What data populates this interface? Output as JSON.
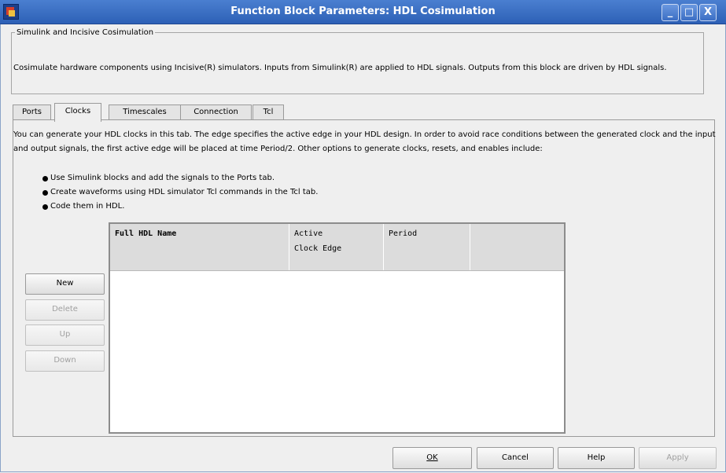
{
  "window": {
    "title": "Function Block Parameters: HDL Cosimulation",
    "controls": [
      "_",
      "□",
      "X"
    ],
    "title_bar_color": "#3a6cc0"
  },
  "group": {
    "legend": "Simulink and Incisive Cosimulation",
    "description": "Cosimulate hardware components using Incisive(R) simulators.  Inputs from Simulink(R) are applied to HDL signals.  Outputs from this block are driven by HDL signals."
  },
  "tabs": [
    {
      "label": "Ports",
      "active": false
    },
    {
      "label": "Clocks",
      "active": true
    },
    {
      "label": "Timescales",
      "active": false
    },
    {
      "label": "Connection",
      "active": false
    },
    {
      "label": "Tcl",
      "active": false
    }
  ],
  "clocks": {
    "intro": "You can generate your HDL clocks in this tab. The edge specifies the active edge in your HDL design. In order to avoid race conditions between the generated clock and the input and output signals, the first active edge will be placed at time Period/2. Other options to generate clocks, resets, and enables include:",
    "bullets": [
      "Use Simulink blocks and add the signals to the Ports tab.",
      "Create waveforms using HDL simulator Tcl commands in the Tcl tab.",
      "Code them in HDL."
    ],
    "buttons": {
      "new": "New",
      "delete": "Delete",
      "up": "Up",
      "down": "Down"
    },
    "table": {
      "headers": {
        "name": "Full HDL Name",
        "edge_line1": "Active",
        "edge_line2": "Clock Edge",
        "period": "Period"
      },
      "rows": []
    }
  },
  "footer": {
    "ok": "OK",
    "cancel": "Cancel",
    "help": "Help",
    "apply": "Apply"
  }
}
